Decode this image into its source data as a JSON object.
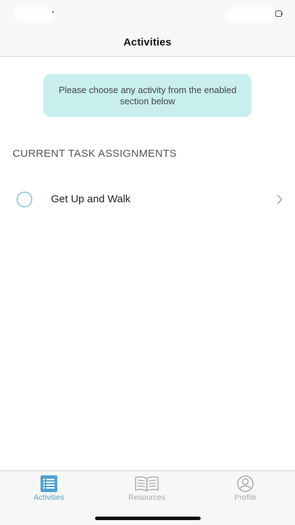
{
  "nav": {
    "title": "Activities"
  },
  "info": {
    "message": "Please choose any activity from the enabled section below"
  },
  "section": {
    "header": "CURRENT TASK ASSIGNMENTS"
  },
  "tasks": [
    {
      "label": "Get Up and Walk",
      "icon": "radio-circle-icon"
    }
  ],
  "tabs": [
    {
      "label": "Activities",
      "icon": "list-icon",
      "active": true
    },
    {
      "label": "Resources",
      "icon": "book-icon",
      "active": false
    },
    {
      "label": "Profile",
      "icon": "person-icon",
      "active": false
    }
  ],
  "colors": {
    "accent": "#4fa3cf",
    "info_background": "#c9eeee",
    "inactive_tab": "#a9a9a9",
    "bar_background": "#f7f7f7"
  }
}
